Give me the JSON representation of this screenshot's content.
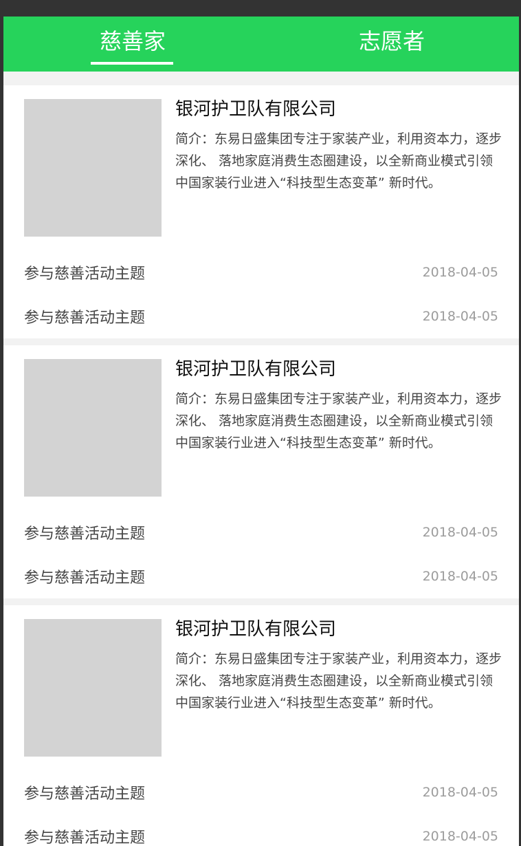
{
  "header": {
    "tabs": [
      {
        "label": "慈善家"
      },
      {
        "label": "志愿者"
      }
    ],
    "active_tab": 0,
    "bg_color": "#26d35b",
    "text_color": "#ffffff"
  },
  "cards": [
    {
      "org_name": "银河护卫队有限公司",
      "intro": "简介：东易日盛集团专注于家装产业，利用资本力，逐步深化、 落地家庭消费生态圈建设，以全新商业模式引领中国家装行业进入“科技型生态变革” 新时代。",
      "activities": [
        {
          "title": "参与慈善活动主题",
          "date": "2018-04-05"
        },
        {
          "title": "参与慈善活动主题",
          "date": "2018-04-05"
        }
      ]
    },
    {
      "org_name": "银河护卫队有限公司",
      "intro": "简介：东易日盛集团专注于家装产业，利用资本力，逐步深化、 落地家庭消费生态圈建设，以全新商业模式引领中国家装行业进入“科技型生态变革” 新时代。",
      "activities": [
        {
          "title": "参与慈善活动主题",
          "date": "2018-04-05"
        },
        {
          "title": "参与慈善活动主题",
          "date": "2018-04-05"
        }
      ]
    },
    {
      "org_name": "银河护卫队有限公司",
      "intro": "简介：东易日盛集团专注于家装产业，利用资本力，逐步深化、 落地家庭消费生态圈建设，以全新商业模式引领中国家装行业进入“科技型生态变革” 新时代。",
      "activities": [
        {
          "title": "参与慈善活动主题",
          "date": "2018-04-05"
        },
        {
          "title": "参与慈善活动主题",
          "date": "2018-04-05"
        }
      ]
    }
  ],
  "colors": {
    "title": "#101010",
    "body_text": "#454545",
    "date_text": "#9c9c9c",
    "placeholder_image": "#d3d3d3"
  }
}
